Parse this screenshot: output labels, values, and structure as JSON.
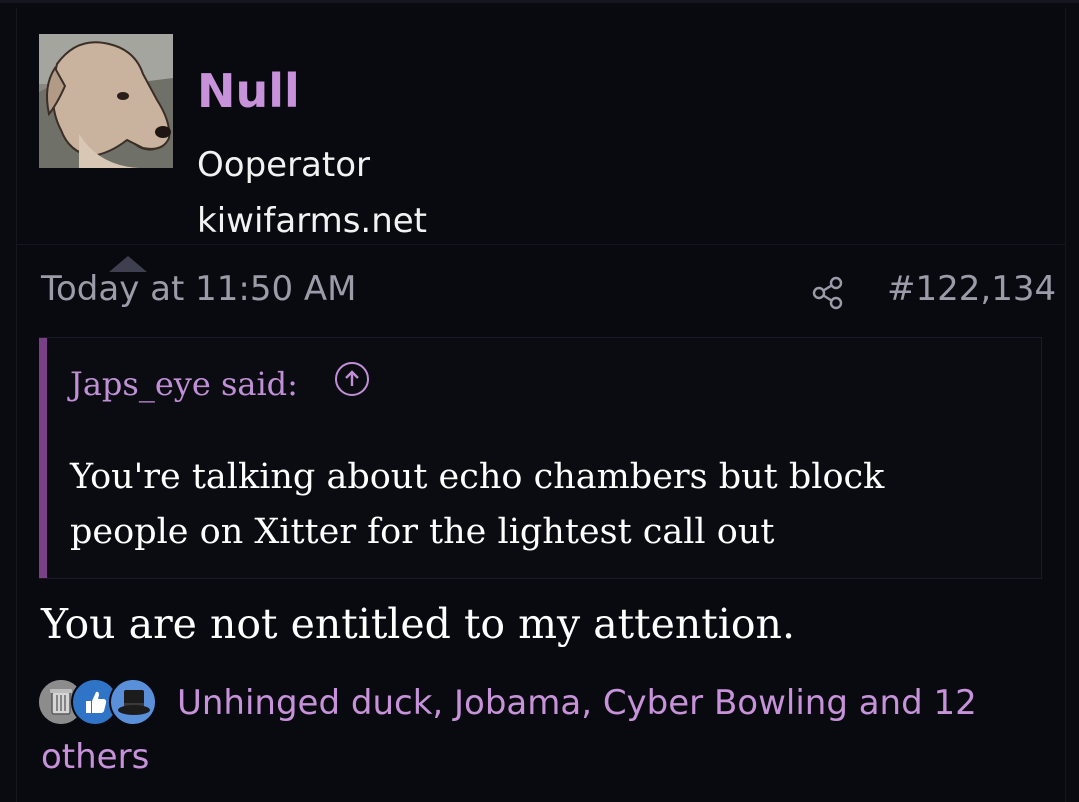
{
  "user": {
    "name": "Null",
    "title": "Ooperator",
    "site": "kiwifarms.net",
    "avatar_icon": "dog-avatar"
  },
  "post": {
    "date": "Today at 11:50 AM",
    "number": "#122,134",
    "share_icon": "share-icon",
    "body": "You are not entitled to my attention."
  },
  "quote": {
    "author": "Japs_eye said:",
    "jump_icon": "arrow-up-circle-icon",
    "text": "You're talking about echo chambers but block people on Xitter for the lightest call out"
  },
  "reactions": {
    "icons": [
      "trash-reaction-icon",
      "like-reaction-icon",
      "top-hat-reaction-icon"
    ],
    "names_line1": "Unhinged duck, Jobama, Cyber Bowling and 12",
    "names_line2": "others"
  },
  "colors": {
    "background": "#0a0b11",
    "username": "#c792d9",
    "quote_bar": "#7a3f86",
    "meta": "#9c9ca8"
  }
}
